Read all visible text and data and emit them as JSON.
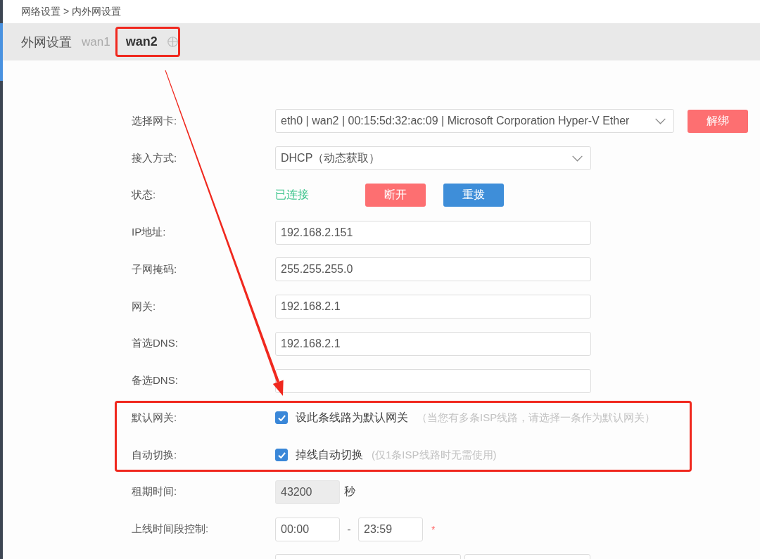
{
  "breadcrumb": "网络设置 > 内外网设置",
  "tab_bar": {
    "title": "外网设置",
    "tabs": [
      {
        "label": "wan1",
        "selected": false,
        "highlighted": false
      },
      {
        "label": "wan2",
        "selected": true,
        "highlighted": true
      }
    ]
  },
  "form": [
    {
      "highlighted": false,
      "rows": [
        {
          "kind": "select",
          "label": "选择网卡:",
          "value": "eth0 | wan2 | 00:15:5d:32:ac:09 | Microsoft Corporation Hyper-V Ether",
          "button": {
            "label": "解绑",
            "color": "#fd6f71"
          }
        },
        {
          "kind": "select",
          "label": "接入方式:",
          "value": "DHCP（动态获取）"
        },
        {
          "kind": "status",
          "label": "状态:",
          "value": "已连接",
          "connected": true,
          "buttons": [
            {
              "label": "断开",
              "color": "#fd6f71"
            },
            {
              "label": "重拨",
              "color": "#3e8ed9"
            }
          ]
        },
        {
          "kind": "text",
          "label": "IP地址:",
          "value": "192.168.2.151"
        },
        {
          "kind": "text",
          "label": "子网掩码:",
          "value": "255.255.255.0"
        },
        {
          "kind": "text",
          "label": "网关:",
          "value": "192.168.2.1"
        },
        {
          "kind": "text",
          "label": "首选DNS:",
          "value": "192.168.2.1"
        },
        {
          "kind": "text",
          "label": "备选DNS:"
        }
      ]
    },
    {
      "highlighted": true,
      "rows": [
        {
          "kind": "checkbox",
          "label": "默认网关:",
          "checked": true,
          "text": "设此条线路为默认网关",
          "hint": "（当您有多条ISP线路，请选择一条作为默认网关）"
        },
        {
          "kind": "checkbox",
          "label": "自动切换:",
          "checked": true,
          "text": "掉线自动切换",
          "hint": "(仅1条ISP线路时无需使用)"
        }
      ]
    },
    {
      "highlighted": false,
      "rows": [
        {
          "kind": "number",
          "label": "租期时间:",
          "value": "43200",
          "disabled": true,
          "unit": "秒"
        },
        {
          "kind": "range",
          "label": "上线时间段控制:",
          "from": "00:00",
          "to": "23:59",
          "separator": "-",
          "required_mark": "*"
        },
        {
          "kind": "pair"
        }
      ]
    }
  ],
  "annotation_arrow": true
}
